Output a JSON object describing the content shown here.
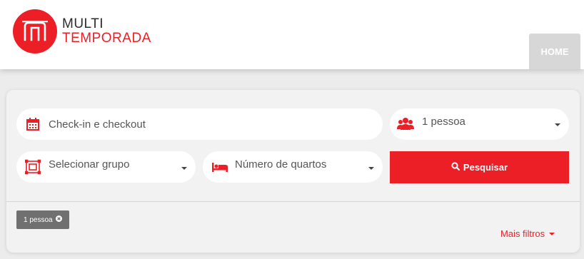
{
  "brand": {
    "line1": "MULTI",
    "line2": "TEMPORADA",
    "color": "#ec1f27"
  },
  "nav": {
    "home": "HOME"
  },
  "search": {
    "checkin_placeholder": "Check-in e checkout",
    "guests_value": "1 pessoa",
    "group_placeholder": "Selecionar grupo",
    "rooms_placeholder": "Número de quartos",
    "submit_label": "Pesquisar"
  },
  "active_filters": [
    {
      "label": "1 pessoa"
    }
  ],
  "more_filters_label": "Mais filtros",
  "icons": {
    "logo": "logo-m-icon",
    "checkin": "calendar-icon",
    "guests": "users-icon",
    "group": "group-select-icon",
    "rooms": "bed-icon",
    "search": "search-icon",
    "remove": "close-icon",
    "dropdown": "caret-down-icon"
  }
}
